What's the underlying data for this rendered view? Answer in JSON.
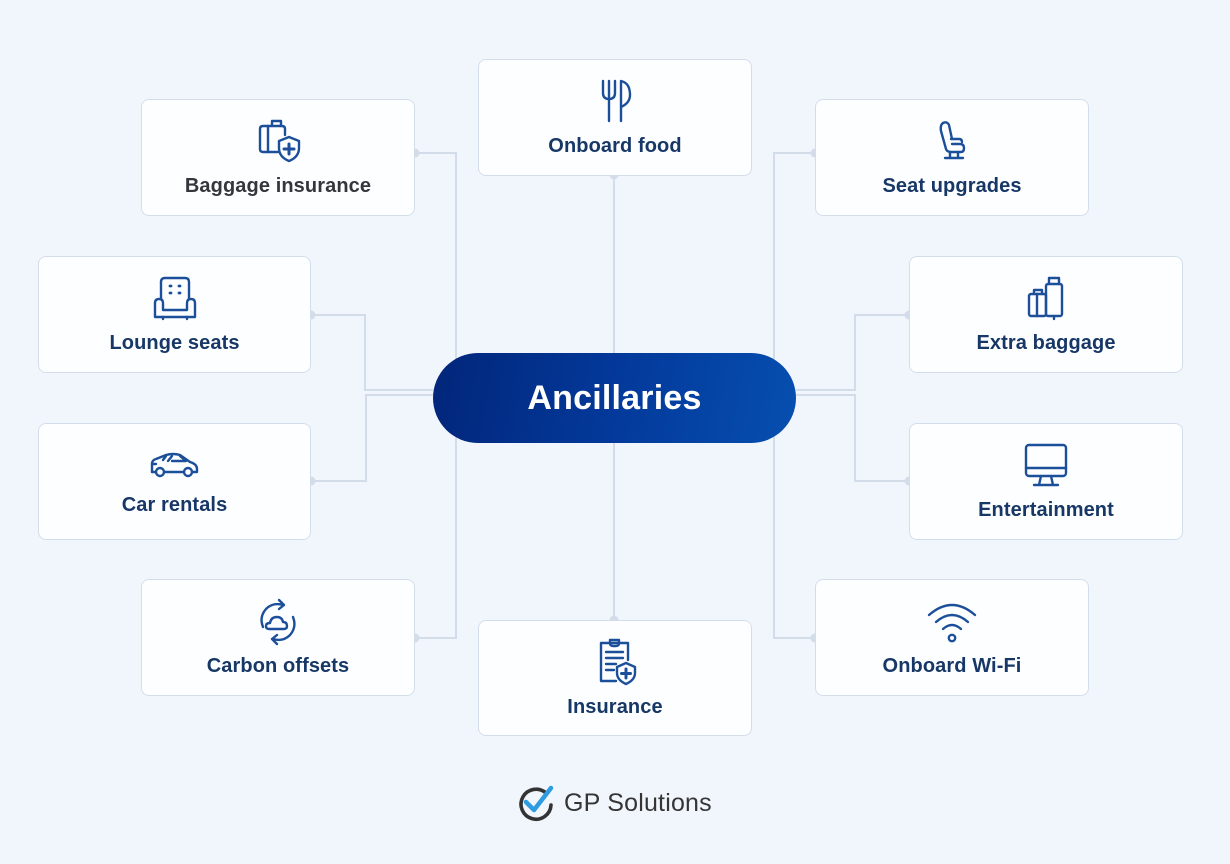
{
  "diagram": {
    "center": {
      "label": "Ancillaries"
    },
    "nodes": [
      {
        "id": "baggage-insurance",
        "label": "Baggage insurance",
        "icon": "suitcase-shield-icon"
      },
      {
        "id": "onboard-food",
        "label": "Onboard food",
        "icon": "fork-knife-icon"
      },
      {
        "id": "seat-upgrades",
        "label": "Seat upgrades",
        "icon": "airplane-seat-icon"
      },
      {
        "id": "lounge-seats",
        "label": "Lounge seats",
        "icon": "armchair-icon"
      },
      {
        "id": "extra-baggage",
        "label": "Extra baggage",
        "icon": "luggage-icon"
      },
      {
        "id": "car-rentals",
        "label": "Car rentals",
        "icon": "car-icon"
      },
      {
        "id": "entertainment",
        "label": "Entertainment",
        "icon": "monitor-icon"
      },
      {
        "id": "carbon-offsets",
        "label": "Carbon offsets",
        "icon": "cloud-cycle-icon"
      },
      {
        "id": "insurance",
        "label": "Insurance",
        "icon": "clipboard-shield-icon"
      },
      {
        "id": "onboard-wifi",
        "label": "Onboard Wi-Fi",
        "icon": "wifi-icon"
      }
    ]
  },
  "brand": {
    "name": "GP Solutions",
    "logo_icon": "checkmark-circle-icon"
  },
  "colors": {
    "background": "#f1f6fd",
    "accent": "#03399a",
    "icon": "#1c4f9a",
    "label": "#173766",
    "connector": "#d4deeb",
    "logo_check": "#2f9be0"
  }
}
